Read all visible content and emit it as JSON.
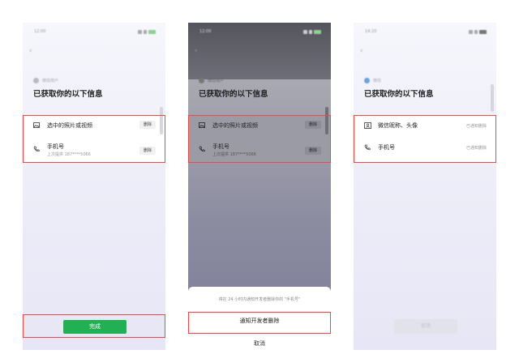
{
  "screens": [
    {
      "status_time": "12:00",
      "app_name": "微信用户",
      "title": "已获取你的以下信息",
      "items": [
        {
          "icon": "image-icon",
          "label": "选中的照片或视频",
          "action": "删除"
        },
        {
          "icon": "phone-icon",
          "label": "手机号",
          "sub": "上次提供 187****5066",
          "action": "删除"
        }
      ],
      "done_button": "完成"
    },
    {
      "status_time": "12:00",
      "app_name": "微信用户",
      "title": "已获取你的以下信息",
      "items": [
        {
          "icon": "image-icon",
          "label": "选中的照片或视频",
          "action": "删除"
        },
        {
          "icon": "phone-icon",
          "label": "手机号",
          "sub": "上次提供 187****5066",
          "action": "删除"
        }
      ],
      "sheet": {
        "info": "将在 24 小时内通知开发者删除你的 \"手机号\"",
        "action": "通知开发者删除",
        "cancel": "取消"
      }
    },
    {
      "status_time": "14:20",
      "app_name": "微信",
      "title": "已获取你的以下信息",
      "items": [
        {
          "icon": "id-card-icon",
          "label": "微信昵称、头像",
          "action": "已通知删除"
        },
        {
          "icon": "phone-icon",
          "label": "手机号",
          "action": "已通知删除"
        }
      ],
      "bottom_button": "管理"
    }
  ],
  "colors": {
    "highlight": "#e84a4a",
    "done_green": "#21b053"
  }
}
